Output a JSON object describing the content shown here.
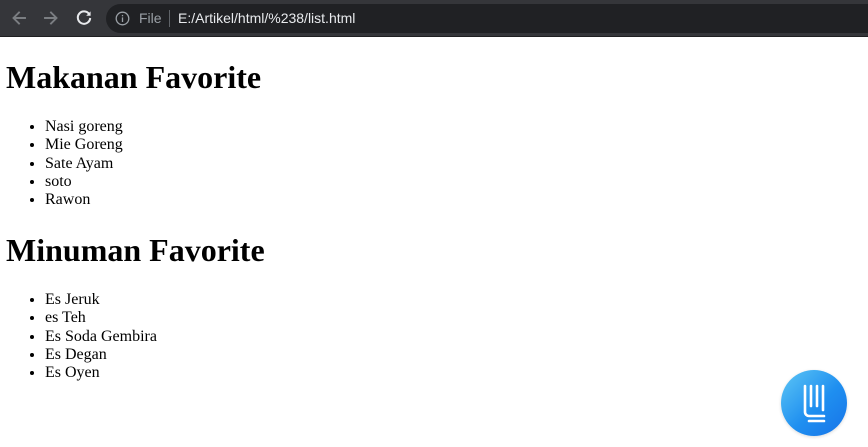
{
  "browser": {
    "file_label": "File",
    "url": "E:/Artikel/html/%238/list.html"
  },
  "page": {
    "sections": [
      {
        "heading": "Makanan Favorite",
        "items": [
          "Nasi goreng",
          "Mie Goreng",
          "Sate Ayam",
          "soto",
          "Rawon"
        ]
      },
      {
        "heading": "Minuman Favorite",
        "items": [
          "Es Jeruk",
          "es Teh",
          "Es Soda Gembira",
          "Es Degan",
          "Es Oyen"
        ]
      }
    ]
  },
  "icons": {
    "back": "arrow-left-icon",
    "forward": "arrow-right-icon",
    "reload": "reload-icon",
    "info": "info-icon",
    "widget": "chat-widget-icon"
  },
  "colors": {
    "toolbar_bg": "#35363a",
    "omnibox_bg": "#202124",
    "url_text": "#e8eaed",
    "widget_accent": "#1f8ff0"
  }
}
